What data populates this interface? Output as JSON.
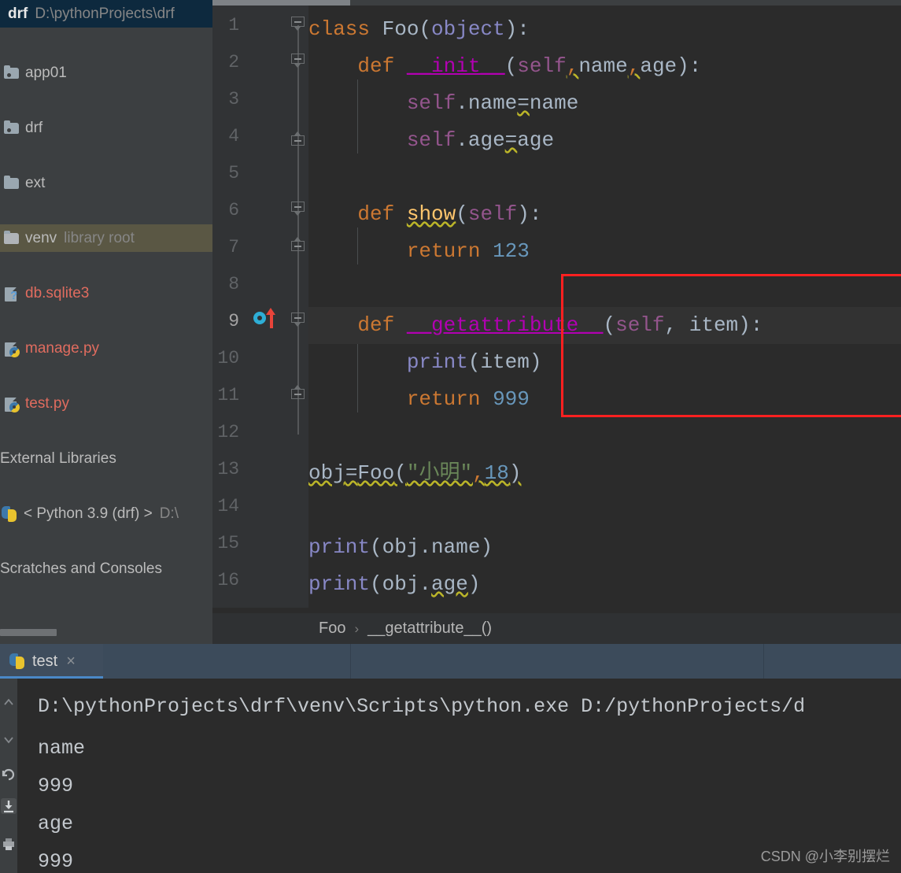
{
  "sidebar": {
    "project": {
      "name": "drf",
      "path": "D:\\pythonProjects\\drf"
    },
    "items": [
      {
        "label": "app01",
        "icon": "module-folder-icon",
        "kind": "module"
      },
      {
        "label": "drf",
        "icon": "module-folder-icon",
        "kind": "module"
      },
      {
        "label": "ext",
        "icon": "folder-icon",
        "kind": "folder"
      },
      {
        "label": "venv",
        "icon": "folder-icon",
        "kind": "folder",
        "badge": "library root",
        "highlight": true
      },
      {
        "label": "db.sqlite3",
        "icon": "unknown-file-icon",
        "kind": "file",
        "color": "red"
      },
      {
        "label": "manage.py",
        "icon": "python-file-icon",
        "kind": "file",
        "color": "red"
      },
      {
        "label": "test.py",
        "icon": "python-file-icon",
        "kind": "file",
        "color": "red"
      }
    ],
    "external_libraries": "External Libraries",
    "interpreter": {
      "label": "< Python 3.9 (drf) >",
      "path": "D:\\",
      "icon": "python-icon"
    },
    "scratches": "Scratches and Consoles"
  },
  "editor": {
    "current_line": 9,
    "line_numbers": [
      1,
      2,
      3,
      4,
      5,
      6,
      7,
      8,
      9,
      10,
      11,
      12,
      13,
      14,
      15,
      16
    ],
    "lines": [
      {
        "n": 1,
        "text": "class Foo(object):"
      },
      {
        "n": 2,
        "text": "    def __init__(self,name,age):"
      },
      {
        "n": 3,
        "text": "        self.name=name"
      },
      {
        "n": 4,
        "text": "        self.age=age"
      },
      {
        "n": 5,
        "text": ""
      },
      {
        "n": 6,
        "text": "    def show(self):"
      },
      {
        "n": 7,
        "text": "        return 123"
      },
      {
        "n": 8,
        "text": ""
      },
      {
        "n": 9,
        "text": "    def __getattribute__(self, item):"
      },
      {
        "n": 10,
        "text": "        print(item)"
      },
      {
        "n": 11,
        "text": "        return 999"
      },
      {
        "n": 12,
        "text": ""
      },
      {
        "n": 13,
        "text": "obj=Foo(\"小明\",18)"
      },
      {
        "n": 14,
        "text": ""
      },
      {
        "n": 15,
        "text": "print(obj.name)"
      },
      {
        "n": 16,
        "text": "print(obj.age)"
      }
    ],
    "tokens": {
      "kw_class": "class",
      "kw_def": "def",
      "kw_return": "return",
      "class_name": "Foo",
      "base": "object",
      "dunder_init": "__init__",
      "dunder_getattribute": "__getattribute__",
      "self": "self",
      "param_name": "name",
      "param_age": "age",
      "param_item": "item",
      "method_show": "show",
      "num_123": "123",
      "num_999": "999",
      "num_18": "18",
      "builtin_print": "print",
      "var_obj": "obj",
      "string_xiaoming": "\"小明\"",
      "attr_name": "name",
      "attr_age": "age"
    },
    "breadcrumb": {
      "class": "Foo",
      "separator": "›",
      "member": "__getattribute__()"
    },
    "annotation": {
      "red_box_note": "highlight-rectangle around lines 9-11",
      "box_color": "#ff2020",
      "override_marker_color": "#2eaed6",
      "override_arrow_color": "#e8443a"
    }
  },
  "console": {
    "tab": {
      "label": "test",
      "icon": "python-file-icon",
      "close": "×"
    },
    "toolbar_icons": [
      "chevron-up-icon",
      "chevron-down-icon",
      "rerun-icon",
      "scroll-to-end-icon",
      "print-icon"
    ],
    "output": [
      "D:\\pythonProjects\\drf\\venv\\Scripts\\python.exe D:/pythonProjects/d",
      "name",
      "999",
      "age",
      "999"
    ]
  },
  "watermark": "CSDN @小李别摆烂",
  "colors": {
    "background": "#2b2b2b",
    "sidebar_bg": "#3c3f41",
    "gutter_bg": "#313335",
    "keyword": "#cc7832",
    "dunder": "#b200b2",
    "self": "#94558d",
    "number": "#6897bb",
    "function": "#ffc66d",
    "builtin": "#8888c6",
    "string": "#6a8759",
    "default_text": "#a9b7c6",
    "accent_tab": "#4a88c7",
    "box_red": "#ff2020"
  }
}
